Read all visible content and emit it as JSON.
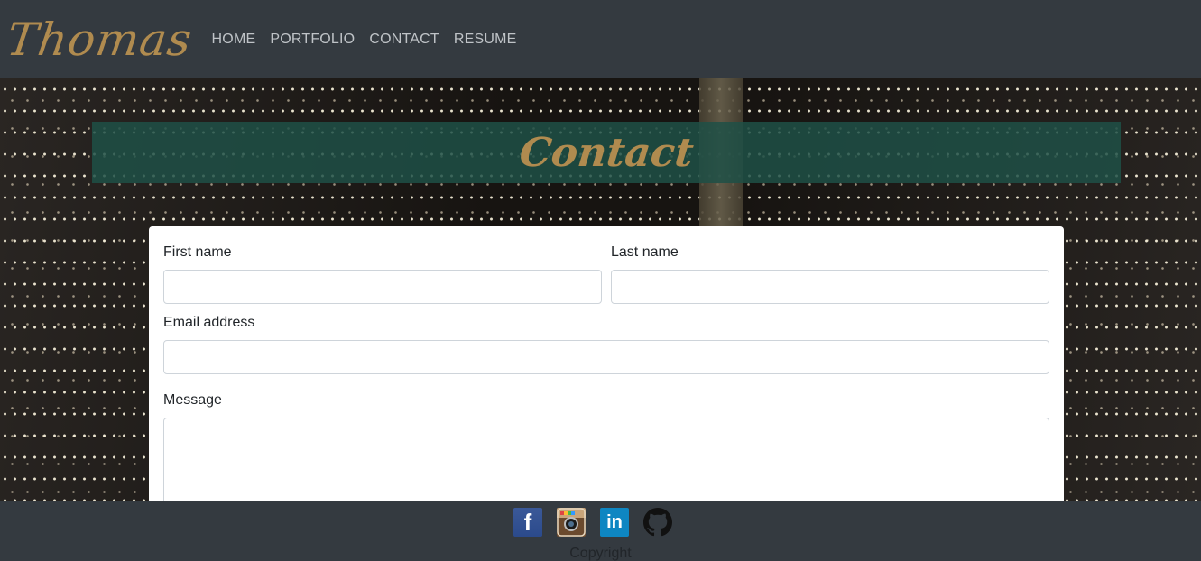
{
  "nav": {
    "brand": "Thomas",
    "links": [
      "HOME",
      "PORTFOLIO",
      "CONTACT",
      "RESUME"
    ]
  },
  "hero": {
    "title": "Contact"
  },
  "form": {
    "first_name_label": "First name",
    "first_name_value": "",
    "last_name_label": "Last name",
    "last_name_value": "",
    "email_label": "Email address",
    "email_value": "",
    "message_label": "Message",
    "message_value": ""
  },
  "footer": {
    "social_icons": [
      "facebook-icon",
      "instagram-icon",
      "linkedin-icon",
      "github-icon"
    ],
    "copyright": "Copyright"
  },
  "colors": {
    "navbar_bg": "#343a40",
    "brand_gold": "#b08b4f",
    "title_band": "#1e5046",
    "nav_link": "#bfc3c7"
  }
}
